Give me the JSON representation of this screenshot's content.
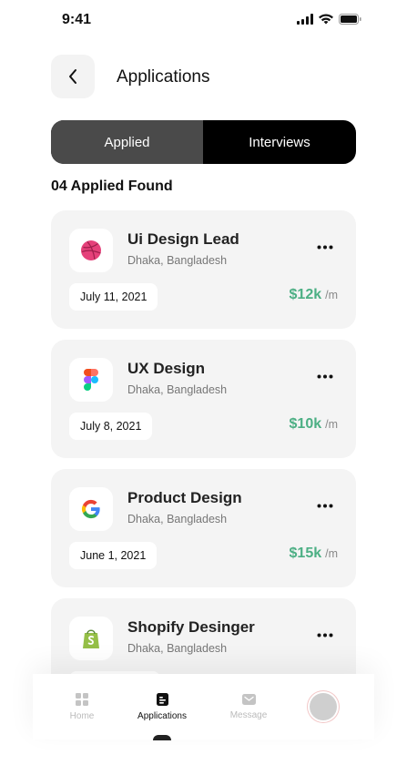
{
  "status": {
    "time": "9:41"
  },
  "header": {
    "title": "Applications"
  },
  "tabs": [
    {
      "label": "Applied"
    },
    {
      "label": "Interviews"
    }
  ],
  "summary": {
    "found_text": "04 Applied Found"
  },
  "jobs": [
    {
      "title": "Ui Design Lead",
      "location": "Dhaka, Bangladesh",
      "date": "July 11, 2021",
      "salary": "$12k",
      "period": "/m",
      "logo": "dribbble-icon"
    },
    {
      "title": "UX Design",
      "location": "Dhaka, Bangladesh",
      "date": "July 8, 2021",
      "salary": "$10k",
      "period": "/m",
      "logo": "figma-icon"
    },
    {
      "title": "Product Design",
      "location": "Dhaka, Bangladesh",
      "date": "June 1, 2021",
      "salary": "$15k",
      "period": "/m",
      "logo": "google-icon"
    },
    {
      "title": "Shopify Desinger",
      "location": "Dhaka, Bangladesh",
      "logo": "shopify-icon"
    }
  ],
  "nav": {
    "items": [
      {
        "label": "Home",
        "icon": "grid-icon"
      },
      {
        "label": "Applications",
        "icon": "document-icon"
      },
      {
        "label": "Message",
        "icon": "mail-icon"
      }
    ]
  },
  "colors": {
    "accent_green": "#4caf84",
    "active_tab": "#4a4a4a",
    "tabs_bg": "#000000"
  }
}
